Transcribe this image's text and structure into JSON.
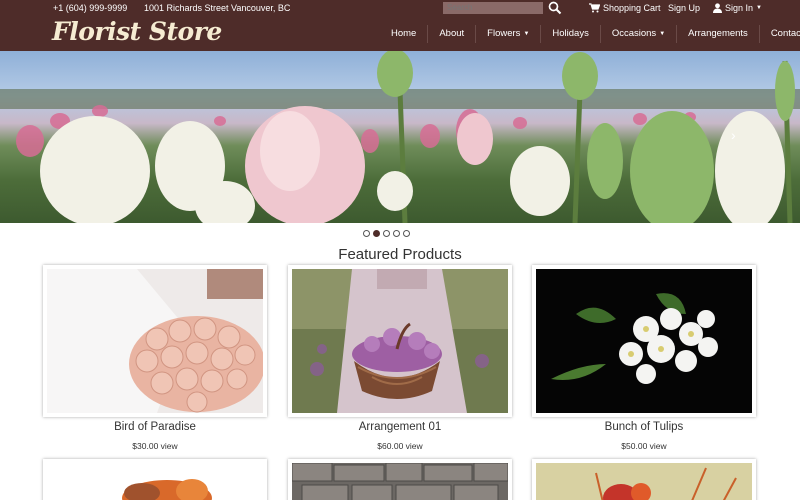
{
  "topbar": {
    "phone": "+1 (604) 999-9999",
    "address": "1001 Richards Street Vancouver, BC",
    "search_placeholder": "Search",
    "cart_label": "Shopping Cart",
    "signup_label": "Sign Up",
    "signin_label": "Sign In"
  },
  "brand": {
    "logo_text": "Florist Store"
  },
  "nav": {
    "items": [
      {
        "label": "Home"
      },
      {
        "label": "About"
      },
      {
        "label": "Flowers"
      },
      {
        "label": "Holidays"
      },
      {
        "label": "Occasions"
      },
      {
        "label": "Arrangements"
      },
      {
        "label": "Contact"
      }
    ]
  },
  "carousel": {
    "slide_count": 5,
    "active_index": 1,
    "next_icon": "chevron-right-icon"
  },
  "featured": {
    "title": "Featured Products",
    "products": [
      {
        "name": "Bird of Paradise",
        "price": "$30.00",
        "view_label": "view"
      },
      {
        "name": "Arrangement 01",
        "price": "$60.00",
        "view_label": "view"
      },
      {
        "name": "Bunch of Tulips",
        "price": "$50.00",
        "view_label": "view"
      }
    ]
  },
  "colors": {
    "header_bg": "#4e2c29",
    "logo": "#f6ecd2",
    "search_bg": "#8a6a68"
  }
}
